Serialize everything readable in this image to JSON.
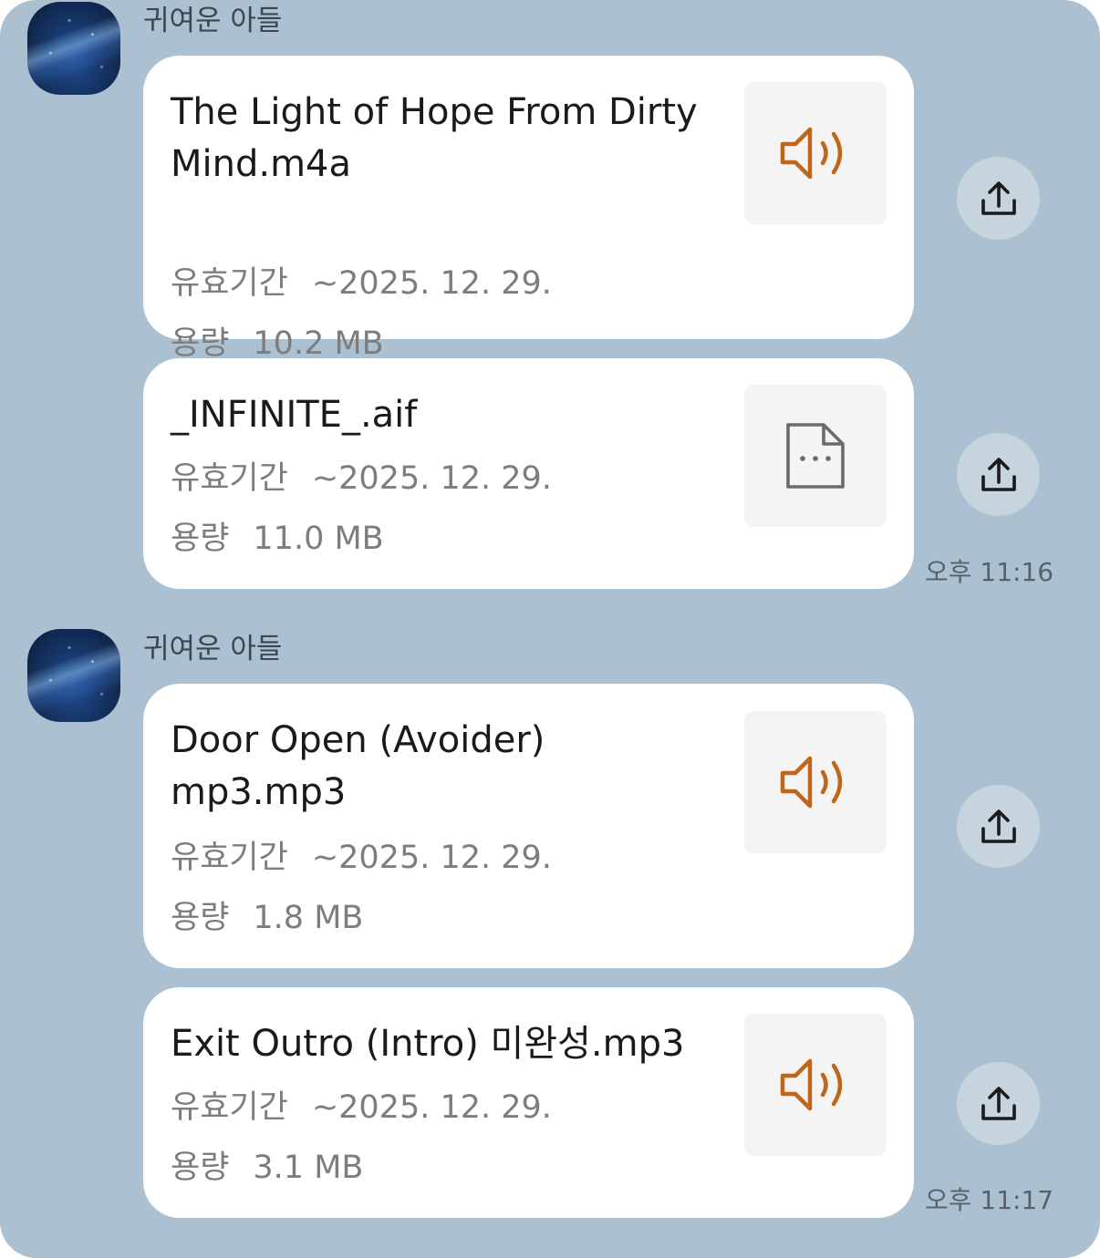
{
  "groups": [
    {
      "sender": "귀여운 아들",
      "time": "오후 11:16",
      "files": [
        {
          "name": "The Light of Hope From Dirty Mind.m4a",
          "expiry_label": "유효기간",
          "expiry": "~2025. 12. 29.",
          "size_label": "용량",
          "size": "10.2 MB",
          "icon": "speaker-icon"
        },
        {
          "name": "_INFINITE_.aif",
          "expiry_label": "유효기간",
          "expiry": "~2025. 12. 29.",
          "size_label": "용량",
          "size": "11.0 MB",
          "icon": "file-icon"
        }
      ]
    },
    {
      "sender": "귀여운 아들",
      "time": "오후 11:17",
      "files": [
        {
          "name": "Door Open (Avoider) mp3.mp3",
          "expiry_label": "유효기간",
          "expiry": "~2025. 12. 29.",
          "size_label": "용량",
          "size": "1.8 MB",
          "icon": "speaker-icon"
        },
        {
          "name": "Exit  Outro (Intro) 미완성.mp3",
          "expiry_label": "유효기간",
          "expiry": "~2025. 12. 29.",
          "size_label": "용량",
          "size": "3.1 MB",
          "icon": "speaker-icon"
        }
      ]
    }
  ],
  "colors": {
    "background": "#abc1d1",
    "bubble": "#ffffff",
    "audio_icon": "#c0661a",
    "file_icon": "#6b6b6b"
  },
  "share_icon": "share-upload-icon"
}
